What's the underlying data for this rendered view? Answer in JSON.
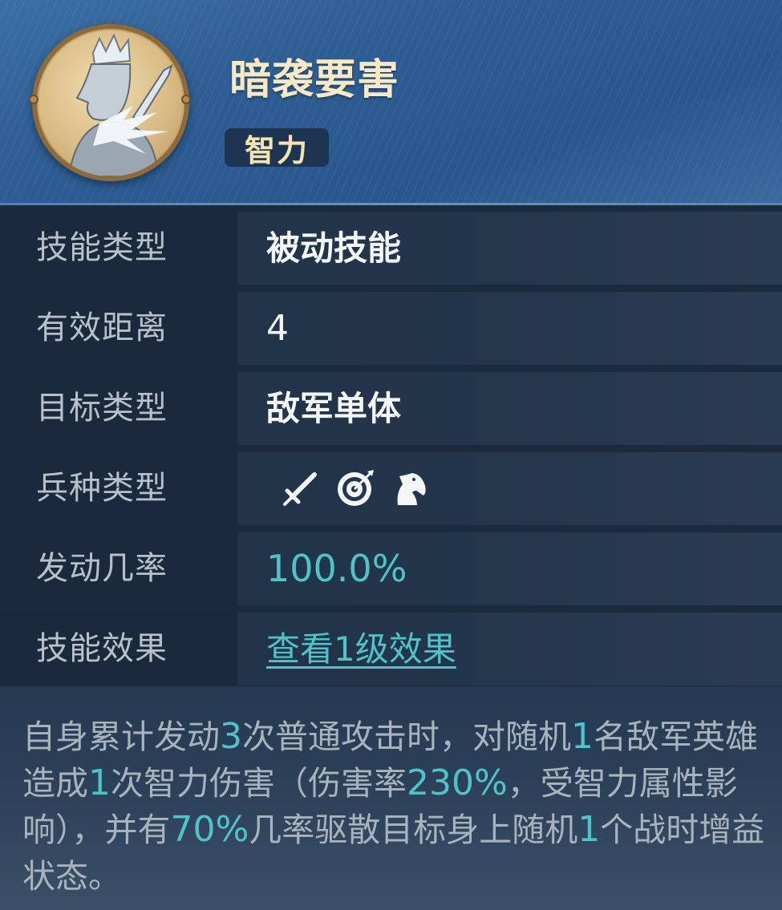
{
  "skill": {
    "name": "暗袭要害",
    "attribute_tag": "智力"
  },
  "rows": [
    {
      "label": "技能类型",
      "value": "被动技能"
    },
    {
      "label": "有效距离",
      "value": "4"
    },
    {
      "label": "目标类型",
      "value": "敌军单体"
    },
    {
      "label": "兵种类型",
      "icons": [
        "sword-icon",
        "target-bow-icon",
        "horse-icon"
      ]
    },
    {
      "label": "发动几率",
      "value": "100.0%"
    },
    {
      "label": "技能效果",
      "value": "查看1级效果"
    }
  ],
  "description": {
    "parts": [
      "自身累计发动",
      "3",
      "次普通攻击时，对随机",
      "1",
      "名敌军英雄造成",
      "1",
      "次智力伤害（伤害率",
      "230%",
      "，受智力属性影响），并有",
      "70%",
      "几率驱散目标身上随机",
      "1",
      "个战时增益状态。"
    ]
  },
  "colors": {
    "highlight": "#4fc3c8",
    "title": "#f6e9c3",
    "label": "#b8c1cb",
    "value": "#f4f6f8"
  }
}
